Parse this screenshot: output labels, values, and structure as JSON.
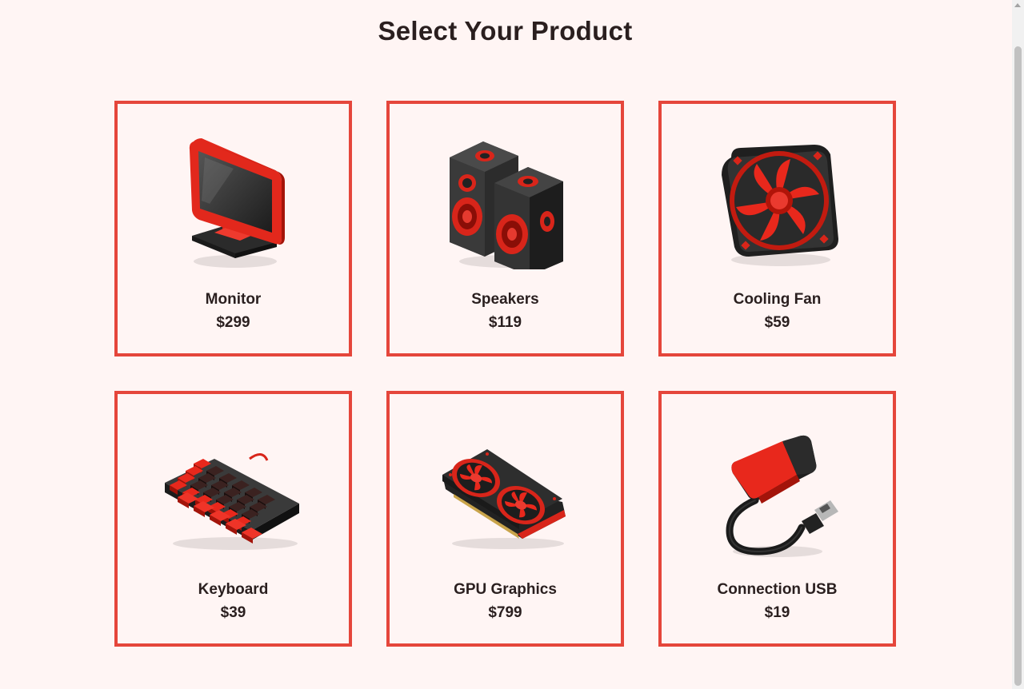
{
  "page": {
    "title": "Select Your Product"
  },
  "products": [
    {
      "name": "Monitor",
      "price": "$299",
      "icon": "monitor-icon"
    },
    {
      "name": "Speakers",
      "price": "$119",
      "icon": "speakers-icon"
    },
    {
      "name": "Cooling Fan",
      "price": "$59",
      "icon": "cooling-fan-icon"
    },
    {
      "name": "Keyboard",
      "price": "$39",
      "icon": "keyboard-icon"
    },
    {
      "name": "GPU Graphics",
      "price": "$799",
      "icon": "gpu-icon"
    },
    {
      "name": "Connection USB",
      "price": "$19",
      "icon": "usb-cable-icon"
    }
  ],
  "colors": {
    "accent": "#e5463b",
    "background": "#fff5f4",
    "text": "#2a1f1f"
  }
}
